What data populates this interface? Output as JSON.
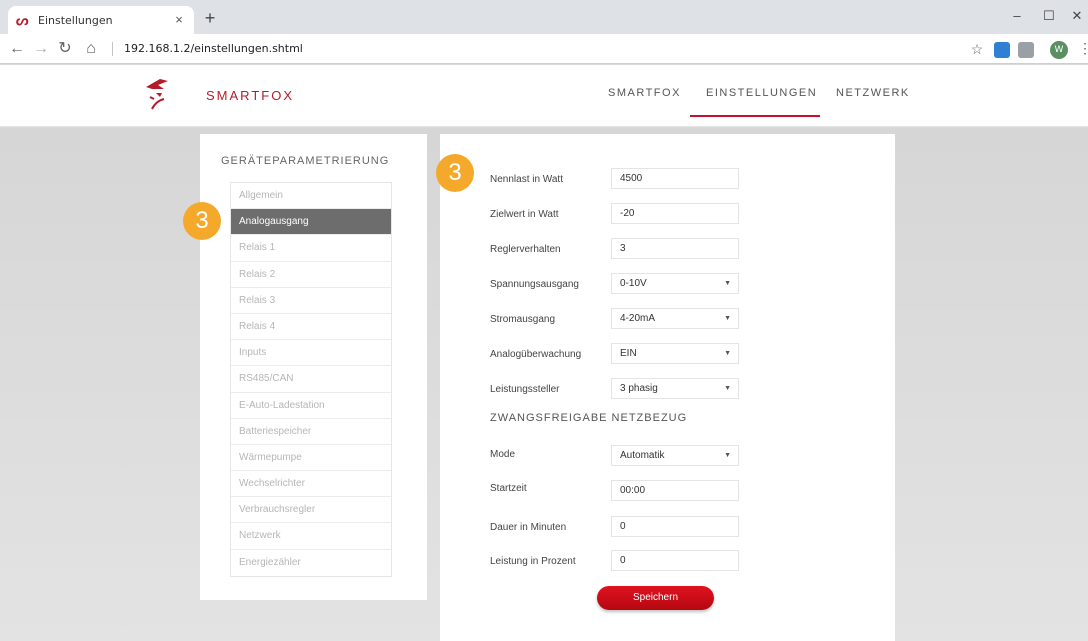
{
  "browser": {
    "tab_title": "Einstellungen",
    "tab_close": "×",
    "new_tab": "+",
    "url": "192.168.1.2/einstellungen.shtml",
    "profile_initial": "W"
  },
  "header": {
    "brand": "SMARTFOX",
    "nav": [
      {
        "label": "SMARTFOX",
        "active": false
      },
      {
        "label": "EINSTELLUNGEN",
        "active": true
      },
      {
        "label": "NETZWERK",
        "active": false
      }
    ],
    "accent_color": "#c8102e"
  },
  "sidebar": {
    "title": "GERÄTEPARAMETRIERUNG",
    "items": [
      {
        "label": "Allgemein",
        "active": false
      },
      {
        "label": "Analogausgang",
        "active": true
      },
      {
        "label": "Relais 1",
        "active": false
      },
      {
        "label": "Relais 2",
        "active": false
      },
      {
        "label": "Relais 3",
        "active": false
      },
      {
        "label": "Relais 4",
        "active": false
      },
      {
        "label": "Inputs",
        "active": false
      },
      {
        "label": "RS485/CAN",
        "active": false
      },
      {
        "label": "E-Auto-Ladestation",
        "active": false
      },
      {
        "label": "Batteriespeicher",
        "active": false
      },
      {
        "label": "Wärmepumpe",
        "active": false
      },
      {
        "label": "Wechselrichter",
        "active": false
      },
      {
        "label": "Verbrauchsregler",
        "active": false
      },
      {
        "label": "Netzwerk",
        "active": false
      },
      {
        "label": "Energiezähler",
        "active": false
      }
    ]
  },
  "badges": {
    "sidebar_step": "3",
    "form_step": "3",
    "color": "#f5a92b"
  },
  "form": {
    "fields": [
      {
        "label": "Nennlast in Watt",
        "value": "4500",
        "type": "text"
      },
      {
        "label": "Zielwert in Watt",
        "value": "-20",
        "type": "text"
      },
      {
        "label": "Reglerverhalten",
        "value": "3",
        "type": "text"
      },
      {
        "label": "Spannungsausgang",
        "value": "0-10V",
        "type": "select"
      },
      {
        "label": "Stromausgang",
        "value": "4-20mA",
        "type": "select"
      },
      {
        "label": "Analogüberwachung",
        "value": "EIN",
        "type": "select"
      },
      {
        "label": "Leistungssteller",
        "value": "3 phasig",
        "type": "select"
      }
    ],
    "section_title": "ZWANGSFREIGABE NETZBEZUG",
    "section_fields": [
      {
        "label": "Mode",
        "value": "Automatik",
        "type": "select"
      },
      {
        "label": "Startzeit",
        "value": "00:00",
        "type": "text"
      },
      {
        "label": "Dauer in Minuten",
        "value": "0",
        "type": "text"
      },
      {
        "label": "Leistung in Prozent",
        "value": "0",
        "type": "text"
      }
    ],
    "save_label": "Speichern"
  }
}
